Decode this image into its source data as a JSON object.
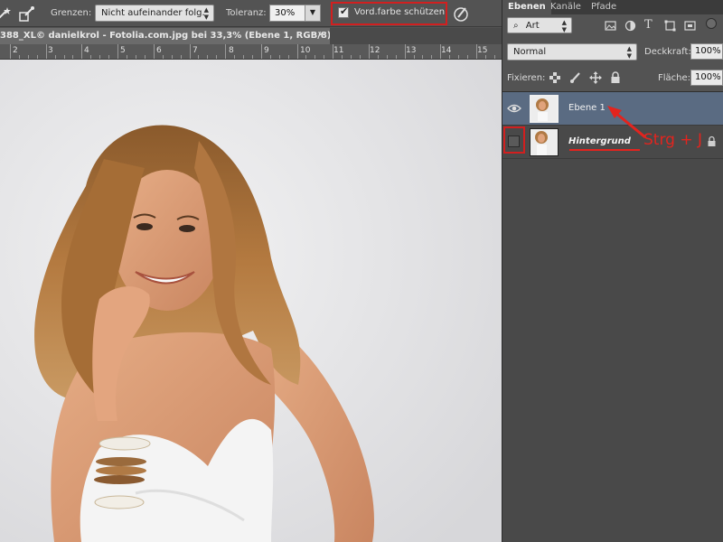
{
  "options_bar": {
    "grenzen_label": "Grenzen:",
    "grenzen_value": "Nicht aufeinander folg.",
    "toleranz_label": "Toleranz:",
    "toleranz_value": "30%",
    "protect_label": "Vord.farbe schützen",
    "protect_checked": true
  },
  "document": {
    "tab_title": "388_XL© danielkrol - Fotolia.com.jpg bei 33,3% (Ebene 1, RGB/8) *",
    "close_glyph": "×",
    "ruler_numbers": [
      "2",
      "3",
      "4",
      "5",
      "6",
      "7",
      "8",
      "9",
      "10",
      "11",
      "12",
      "13",
      "14",
      "15"
    ]
  },
  "panel": {
    "tabs": [
      "Ebenen",
      "Kanäle",
      "Pfade"
    ],
    "active_tab": "Ebenen",
    "filter_value": "Art",
    "blend_mode": "Normal",
    "opacity_label": "Deckkraft:",
    "opacity_value": "100%",
    "lock_label": "Fixieren:",
    "fill_label": "Fläche:",
    "fill_value": "100%",
    "layers": [
      {
        "name": "Ebene 1",
        "selected": true,
        "visible": true
      },
      {
        "name": "Hintergrund",
        "selected": false,
        "visible": false,
        "locked": true
      }
    ]
  },
  "annotation": {
    "text": "Strg + J",
    "color": "#e3241e"
  },
  "colors": {
    "panel_bg": "#535353",
    "selected_layer": "#5a6b82",
    "highlight_red": "#d21f1f"
  }
}
